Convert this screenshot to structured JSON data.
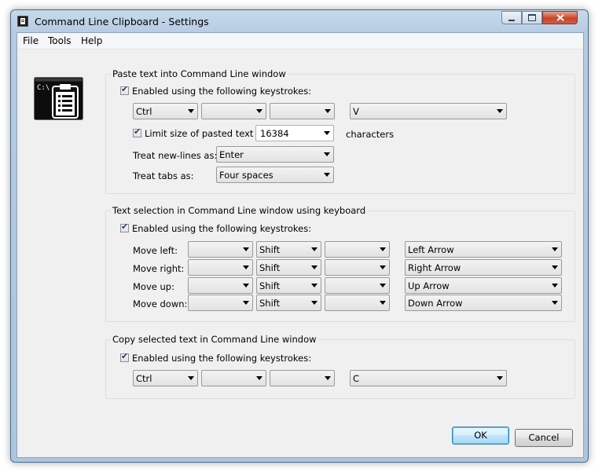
{
  "window": {
    "title": "Command Line Clipboard - Settings"
  },
  "menu": {
    "file": "File",
    "tools": "Tools",
    "help": "Help"
  },
  "app_logo": {
    "text": "C:\\"
  },
  "paste": {
    "group_label": "Paste text into Command Line window",
    "enabled_label": "Enabled using the following keystrokes:",
    "enabled": true,
    "keys": [
      "Ctrl",
      "",
      "",
      "V"
    ],
    "limit_label": "Limit size of pasted text to",
    "limit_enabled": true,
    "limit_value": "16384",
    "limit_unit": "characters",
    "newlines_label": "Treat new-lines as:",
    "newlines_value": "Enter",
    "tabs_label": "Treat tabs as:",
    "tabs_value": "Four spaces"
  },
  "selection": {
    "group_label": "Text selection in Command Line window using keyboard",
    "enabled_label": "Enabled using the following keystrokes:",
    "enabled": true,
    "rows": [
      {
        "label": "Move left:",
        "keys": [
          "",
          "Shift",
          "",
          "Left Arrow"
        ]
      },
      {
        "label": "Move right:",
        "keys": [
          "",
          "Shift",
          "",
          "Right Arrow"
        ]
      },
      {
        "label": "Move up:",
        "keys": [
          "",
          "Shift",
          "",
          "Up Arrow"
        ]
      },
      {
        "label": "Move down:",
        "keys": [
          "",
          "Shift",
          "",
          "Down Arrow"
        ]
      }
    ]
  },
  "copy": {
    "group_label": "Copy selected text in Command Line window",
    "enabled_label": "Enabled using the following keystrokes:",
    "enabled": true,
    "keys": [
      "Ctrl",
      "",
      "",
      "C"
    ]
  },
  "buttons": {
    "ok": "OK",
    "cancel": "Cancel"
  },
  "colors": {
    "title_bar": "#b9cee5",
    "dialog_bg": "#f0f0f0",
    "close_button": "#c8452c",
    "checkmark": "#1f3f6f"
  }
}
